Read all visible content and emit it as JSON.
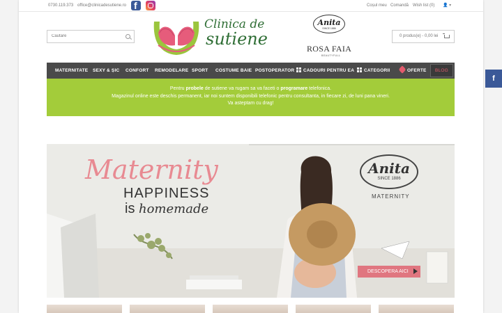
{
  "topbar": {
    "phone": "0730.119.373",
    "email": "office@clinicadesutiene.ro",
    "social": [
      "facebook-icon",
      "instagram-icon"
    ],
    "links": [
      "Coșul meu",
      "Comandă",
      "Wish list (0)"
    ],
    "user_menu": "👤 ▾"
  },
  "header": {
    "search_placeholder": "Căutare",
    "logo_line1": "Clinica de",
    "logo_line2": "sutiene",
    "brand1_name": "Anita",
    "brand1_since": "SINCE 1886",
    "brand2_name": "ROSA FAIA",
    "brand2_sub": "BEAUTYFULL",
    "cart_label": "0 produs(e) - 0,00 lei"
  },
  "nav": {
    "items": [
      "MATERNITATE",
      "SEXY & ȘIC",
      "CONFORT",
      "REMODELARE",
      "SPORT",
      "COSTUME BAIE",
      "POSTOPERATOR",
      "CADOURI PENTRU EA",
      "CATEGORII",
      "OFERTE",
      "BLOG"
    ]
  },
  "notice": {
    "l1_a": "Pentru ",
    "l1_b": "probele",
    "l1_c": " de sutiene va rugam sa va faceti o ",
    "l1_d": "programare",
    "l1_e": " telefonica.",
    "l2": "Magazinul online este deschis permanent, iar noi suntem disponibili telefonic pentru consultanta, in fiecare zi, de luni pana vineri.",
    "l3": "Va asteptam cu drag!"
  },
  "hero": {
    "title": "Maternity",
    "line2": "HAPPINESS",
    "line3a": "is ",
    "line3b": "homemade",
    "brand": "Anita",
    "brand_since": "SINCE 1886",
    "brand_sub": "MATERNITY",
    "cta": "DESCOPERA AICI"
  },
  "colors": {
    "nav_bg": "#4a4a4a",
    "notice_bg": "#a3cc3a",
    "accent_pink": "#e07680",
    "logo_green": "#2f6e35",
    "facebook": "#3b5998"
  }
}
